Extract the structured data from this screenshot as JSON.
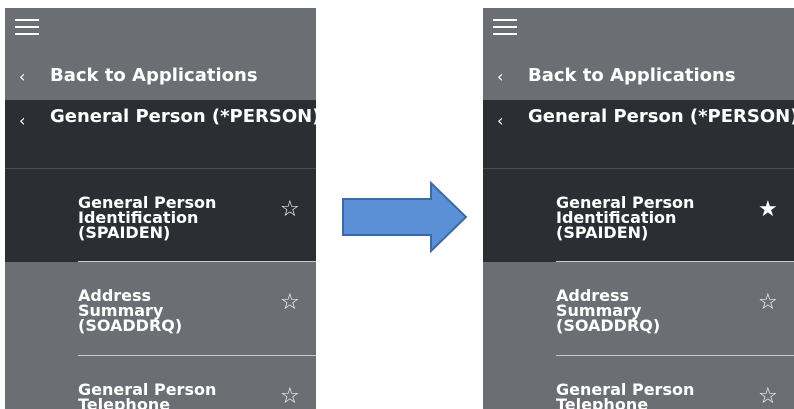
{
  "panels": {
    "before": {
      "menu_icon": "hamburger-icon",
      "back_label": "Back to Applications",
      "section_title": "General Person (*PERSON)",
      "items": [
        {
          "label": "General Person Identification (SPAIDEN)",
          "star": "☆",
          "favorited": false
        },
        {
          "label": "Address Summary (SOADDRQ)",
          "star": "☆",
          "favorited": false
        },
        {
          "label": "General Person Telephone",
          "star": "☆",
          "favorited": false
        }
      ]
    },
    "after": {
      "menu_icon": "hamburger-icon",
      "back_label": "Back to Applications",
      "section_title": "General Person (*PERSON)",
      "items": [
        {
          "label": "General Person Identification (SPAIDEN)",
          "star": "★",
          "favorited": true
        },
        {
          "label": "Address Summary (SOADDRQ)",
          "star": "☆",
          "favorited": false
        },
        {
          "label": "General Person Telephone",
          "star": "☆",
          "favorited": false
        }
      ]
    }
  },
  "chev": "‹",
  "colors": {
    "panel_bg": "#6b6e72",
    "dark_bg": "#2b2f33",
    "arrow_fill": "#5b8fd6",
    "arrow_stroke": "#3b6aa8"
  }
}
